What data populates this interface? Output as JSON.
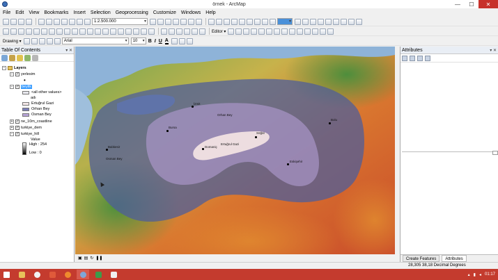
{
  "window": {
    "title": "örnek - ArcMap",
    "controls": {
      "minimize": "—",
      "maximize": "☐",
      "close": "✕"
    }
  },
  "menu": [
    "File",
    "Edit",
    "View",
    "Bookmarks",
    "Insert",
    "Selection",
    "Geoprocessing",
    "Customize",
    "Windows",
    "Help"
  ],
  "standard_toolbar": {
    "scale": "1:2.500.000"
  },
  "editor_label": "Editor ▾",
  "drawing_toolbar": {
    "drawing_label": "Drawing ▾",
    "font": "Arial",
    "font_size": "10",
    "bold": "B",
    "italic": "I",
    "underline": "U",
    "font_color": "A"
  },
  "toc": {
    "title": "Table Of Contents",
    "pin": "▾ ✕",
    "layers_group": "Layers",
    "items": [
      {
        "label": "yerlesim",
        "checked": "✓"
      },
      {
        "label": "•",
        "kind": "point-symbol"
      },
      {
        "label": "beylik",
        "checked": "✓",
        "selected": true
      },
      {
        "label": "<all other values>"
      },
      {
        "label": "adı"
      },
      {
        "label": "Ertuğrul Gazi",
        "color": "#f3e7e7"
      },
      {
        "label": "Orhan Bey",
        "color": "#7b7fb8"
      },
      {
        "label": "Osman Bey",
        "color": "#b6a3d6"
      },
      {
        "label": "ne_10m_coastline",
        "checked": "✓"
      },
      {
        "label": "turkiye_dem",
        "checked": "✓"
      },
      {
        "label": "turkiye_hill",
        "checked": "✓"
      },
      {
        "label": "Value"
      },
      {
        "label": "High : 254"
      },
      {
        "label": "Low : 0"
      }
    ]
  },
  "map": {
    "labels": [
      {
        "name": "Izmit",
        "text": "İzmit"
      },
      {
        "name": "Orhan-Bey",
        "text": "Orhan Bey"
      },
      {
        "name": "Bursa",
        "text": "Bursa"
      },
      {
        "name": "Sogut",
        "text": "Söğüt"
      },
      {
        "name": "Ertugrul-Gazi",
        "text": "Ertuğrul Gazi"
      },
      {
        "name": "Domanic",
        "text": "Domaniç"
      },
      {
        "name": "Eskisehir",
        "text": "Eskişehir"
      },
      {
        "name": "Bolu",
        "text": "Bolu"
      },
      {
        "name": "Balikesir",
        "text": "Balıkesir"
      },
      {
        "name": "Osman-Bey",
        "text": "Osman Bey"
      }
    ]
  },
  "attributes": {
    "title": "Attributes",
    "pin": "▾ ✕",
    "tabs": [
      "Create Features",
      "Attributes"
    ]
  },
  "status": {
    "coordinates": "28,305  38,18 Decimal Degrees"
  },
  "taskbar": {
    "time": "01:17"
  }
}
